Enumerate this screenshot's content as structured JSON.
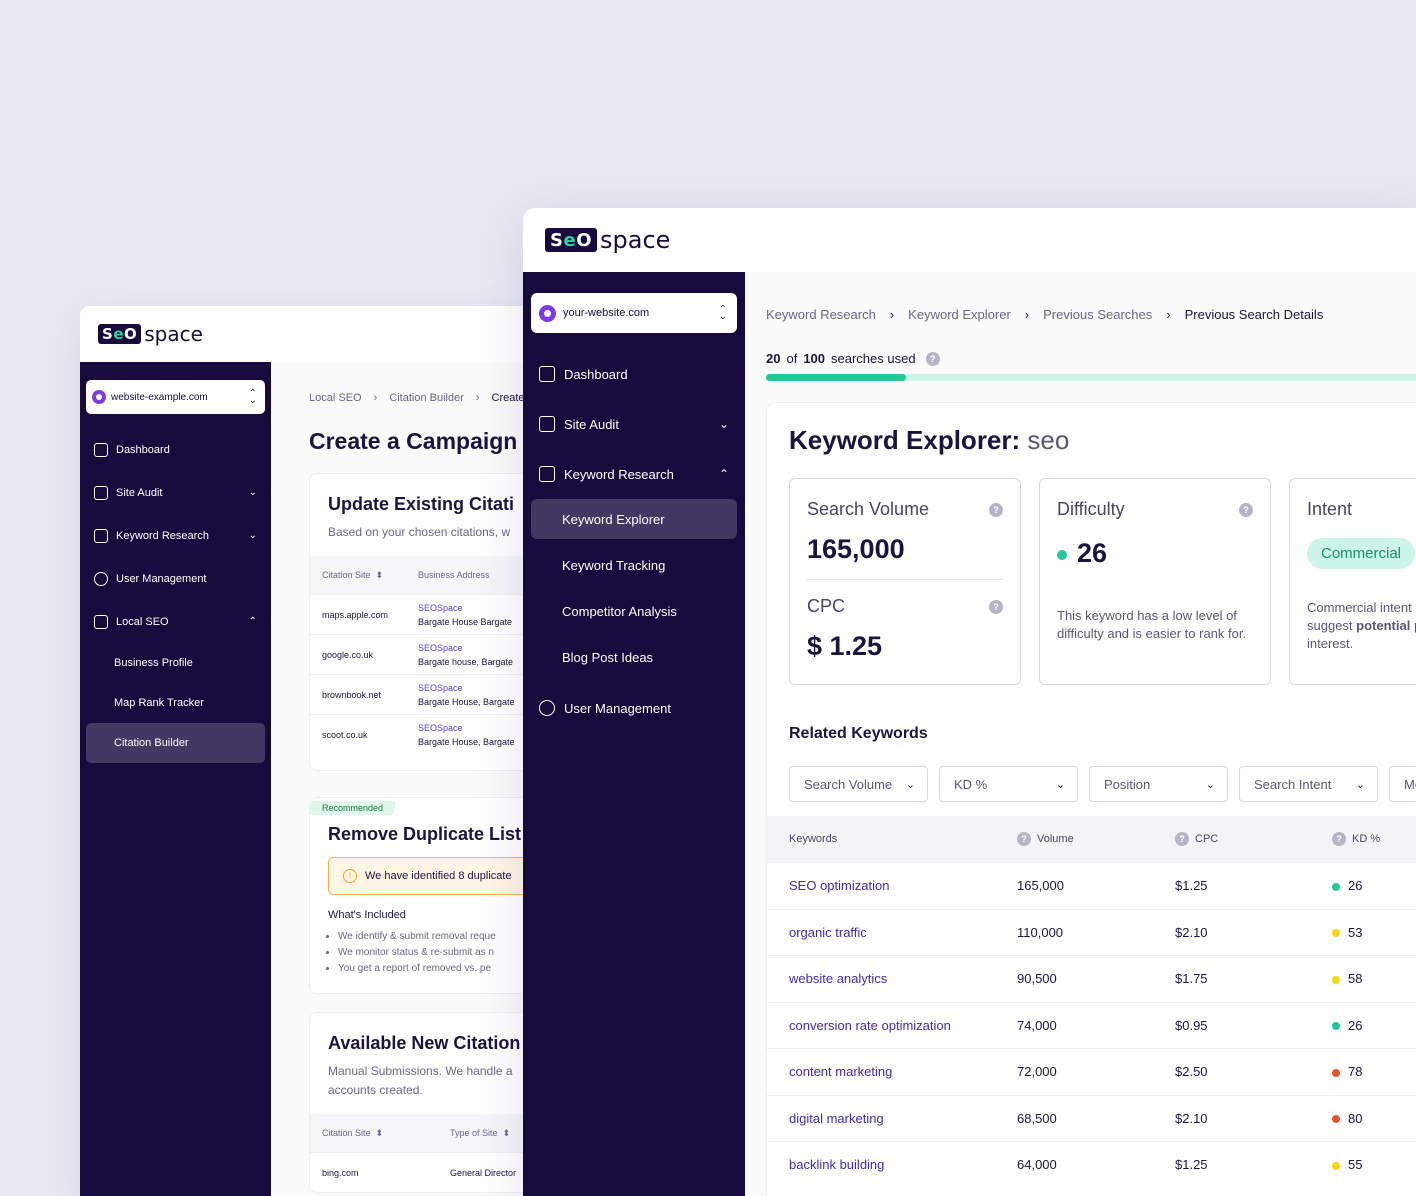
{
  "back": {
    "site": "website-example.com",
    "nav": [
      {
        "label": "Dashboard"
      },
      {
        "label": "Site Audit",
        "chevron": "⌄"
      },
      {
        "label": "Keyword Research",
        "chevron": "⌄"
      },
      {
        "label": "User Management"
      },
      {
        "label": "Local SEO",
        "chevron": "⌃"
      }
    ],
    "sub": [
      "Business Profile",
      "Map Rank Tracker",
      "Citation Builder"
    ],
    "crumbs": [
      "Local SEO",
      "Citation Builder",
      "Create"
    ],
    "title": "Create a Campaign",
    "card1": {
      "title": "Update Existing Citati",
      "sub": "Based on your chosen citations, w",
      "headers": [
        "Citation Site",
        "Business Address"
      ],
      "rows": [
        {
          "site": "maps.apple.com",
          "name": "SEOSpace",
          "addr": "Bargate House Bargate"
        },
        {
          "site": "google.co.uk",
          "name": "SEOSpace",
          "addr": "Bargate house, Bargate"
        },
        {
          "site": "brownbook.net",
          "name": "SEOSpace",
          "addr": "Bargate House, Bargate"
        },
        {
          "site": "scoot.co.uk",
          "name": "SEOSpace",
          "addr": "Bargate House, Bargate"
        }
      ]
    },
    "card2": {
      "badge": "Recommended",
      "title": "Remove Duplicate List",
      "warning": "We have identified 8 duplicate",
      "included": "What's Included",
      "bullets": [
        "We identify & submit removal reque",
        "We monitor status & re-submit as n",
        "You get a report of removed vs. pe"
      ]
    },
    "card3": {
      "title": "Available New Citation",
      "sub1": "Manual Submissions. We handle a",
      "sub2": "accounts created.",
      "headers": [
        "Citation Site",
        "Type of Site"
      ],
      "rows": [
        {
          "site": "bing.com",
          "type": "General Director"
        }
      ]
    }
  },
  "front": {
    "site": "your-website.com",
    "nav": {
      "dashboard": "Dashboard",
      "site_audit": "Site Audit",
      "keyword_research": "Keyword Research",
      "user_management": "User Management"
    },
    "sub": [
      "Keyword Explorer",
      "Keyword Tracking",
      "Competitor Analysis",
      "Blog Post Ideas"
    ],
    "crumbs": [
      "Keyword Research",
      "Keyword Explorer",
      "Previous Searches",
      "Previous Search Details"
    ],
    "usage": {
      "used": "20",
      "of": "of",
      "total": "100",
      "suffix": "searches used",
      "fraction": 0.2
    },
    "title": "Keyword Explorer:",
    "keyword": "seo",
    "search_volume": {
      "label": "Search Volume",
      "value": "165,000"
    },
    "cpc": {
      "label": "CPC",
      "value": "$ 1.25"
    },
    "difficulty": {
      "label": "Difficulty",
      "value": "26",
      "desc": "This keyword has a low level of difficulty and is easier to rank for."
    },
    "intent": {
      "label": "Intent",
      "pill": "Commercial",
      "desc1": "Commercial intent",
      "desc2": "suggest",
      "desc2b": "potential p",
      "desc3": "interest."
    },
    "related": "Related Keywords",
    "filters": [
      "Search Volume",
      "KD %",
      "Position",
      "Search Intent",
      "Mo"
    ],
    "table": {
      "headers": [
        "Keywords",
        "Volume",
        "CPC",
        "KD %"
      ],
      "rows": [
        {
          "kw": "SEO optimization",
          "vol": "165,000",
          "cpc": "$1.25",
          "kd": "26",
          "color": "#20c997"
        },
        {
          "kw": "organic traffic",
          "vol": "110,000",
          "cpc": "$2.10",
          "kd": "53",
          "color": "#f5d90a"
        },
        {
          "kw": "website analytics",
          "vol": "90,500",
          "cpc": "$1.75",
          "kd": "58",
          "color": "#f5d90a"
        },
        {
          "kw": "conversion rate optimization",
          "vol": "74,000",
          "cpc": "$0.95",
          "kd": "26",
          "color": "#20c997"
        },
        {
          "kw": "content marketing",
          "vol": "72,000",
          "cpc": "$2.50",
          "kd": "78",
          "color": "#e8532a"
        },
        {
          "kw": "digital marketing",
          "vol": "68,500",
          "cpc": "$2.10",
          "kd": "80",
          "color": "#e8532a"
        },
        {
          "kw": "backlink building",
          "vol": "64,000",
          "cpc": "$1.25",
          "kd": "55",
          "color": "#f5d90a"
        }
      ]
    },
    "colors": {
      "accent": "#20c997",
      "sidebar": "#170a3d",
      "link": "#3d2bb8"
    }
  }
}
